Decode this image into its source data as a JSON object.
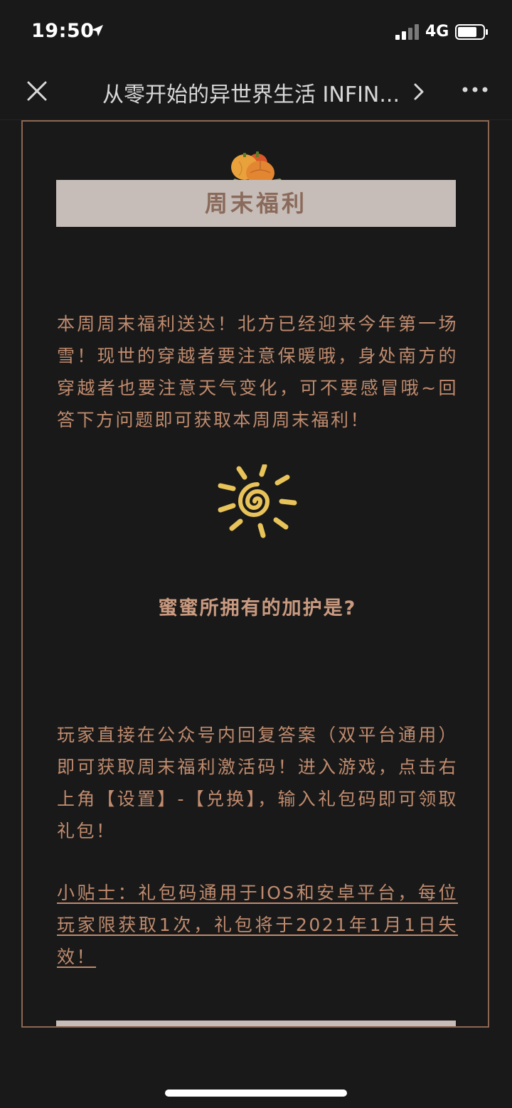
{
  "status_bar": {
    "time": "19:50",
    "network": "4G"
  },
  "nav": {
    "title": "从零开始的异世界生活 INFIN...",
    "close_icon": "close-icon",
    "more_icon": "more-icon"
  },
  "article": {
    "banner_title": "周末福利",
    "intro": "本周周末福利送达！北方已经迎来今年第一场雪！现世的穿越者要注意保暖哦，身处南方的穿越者也要注意天气变化，可不要感冒哦~回答下方问题即可获取本周周末福利！",
    "question": "蜜蜜所拥有的加护是?",
    "instructions": "玩家直接在公众号内回复答案（双平台通用）即可获取周末福利激活码！进入游戏，点击右上角【设置】-【兑换】，输入礼包码即可领取礼包！",
    "tip": "小贴士：礼包码通用于IOS和安卓平台，每位玩家限获取1次，礼包将于2021年1月1日失效！"
  },
  "colors": {
    "background": "#191919",
    "frame_border": "#8c6653",
    "banner": "#c6bdb8",
    "body_text": "#c08b6e",
    "sun": "#e8c35a"
  }
}
